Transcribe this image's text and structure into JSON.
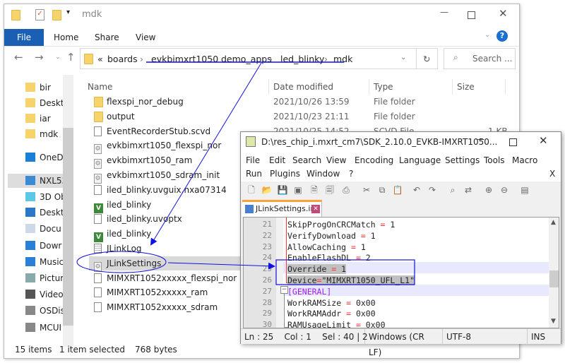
{
  "explorer": {
    "title": "mdk",
    "ribbon_tabs": [
      "File",
      "Home",
      "Share",
      "View"
    ],
    "breadcrumb": [
      "boards",
      "evkbimxrt1050",
      "demo_apps",
      "led_blinky",
      "mdk"
    ],
    "breadcrumb_overflow": "«",
    "search_placeholder": "Search ...",
    "columns": [
      "Name",
      "Date modified",
      "Type",
      "Size"
    ],
    "nav": [
      {
        "label": "bir",
        "icon": "folder-synced-icon"
      },
      {
        "label": "Deskt",
        "icon": "folder-icon"
      },
      {
        "label": "iar",
        "icon": "folder-icon"
      },
      {
        "label": "mdk",
        "icon": "folder-icon"
      },
      {
        "label": "OneDri",
        "icon": "onedrive-icon"
      },
      {
        "label": "NXL535",
        "icon": "computer-icon"
      },
      {
        "label": "3D Ob",
        "icon": "3d-objects-icon"
      },
      {
        "label": "Deskt",
        "icon": "desktop-icon"
      },
      {
        "label": "Docu",
        "icon": "documents-icon"
      },
      {
        "label": "Dowr",
        "icon": "downloads-icon"
      },
      {
        "label": "Music",
        "icon": "music-icon"
      },
      {
        "label": "Pictur",
        "icon": "pictures-icon"
      },
      {
        "label": "Video",
        "icon": "videos-icon"
      },
      {
        "label": "OSDis",
        "icon": "drive-icon"
      },
      {
        "label": "MCUI",
        "icon": "drive-icon"
      }
    ],
    "files": [
      {
        "name": "flexspi_nor_debug",
        "date": "2021/10/26 13:59",
        "type": "File folder",
        "size": "",
        "icon": "folder"
      },
      {
        "name": "output",
        "date": "2021/10/23 21:11",
        "type": "File folder",
        "size": "",
        "icon": "folder"
      },
      {
        "name": "EventRecorderStub.scvd",
        "date": "2021/10/25 14:52",
        "type": "SCVD File",
        "size": "1 KB",
        "icon": "file"
      },
      {
        "name": "evkbimxrt1050_flexspi_nor",
        "icon": "gear"
      },
      {
        "name": "evkbimxrt1050_ram",
        "icon": "gear"
      },
      {
        "name": "evkbimxrt1050_sdram_init",
        "icon": "gear"
      },
      {
        "name": "iled_blinky.uvguix.nxa07314",
        "icon": "file"
      },
      {
        "name": "iled_blinky",
        "icon": "vs"
      },
      {
        "name": "iled_blinky.uvoptx",
        "icon": "file"
      },
      {
        "name": "iled_blinky",
        "icon": "vs"
      },
      {
        "name": "JLinkLog",
        "icon": "text"
      },
      {
        "name": "JLinkSettings",
        "icon": "gear",
        "selected": true
      },
      {
        "name": "MIMXRT1052xxxxx_flexspi_nor",
        "icon": "file"
      },
      {
        "name": "MIMXRT1052xxxxx_ram",
        "icon": "file"
      },
      {
        "name": "MIMXRT1052xxxxx_sdram",
        "icon": "file"
      }
    ],
    "status": {
      "items": "15 items",
      "selected": "1 item selected",
      "size": "768 bytes"
    }
  },
  "npp": {
    "title": "D:\\res_chip_i.mxrt_cm7\\SDK_2.10.0_EVKB-IMXRT1050...",
    "menu_row1": [
      "File",
      "Edit",
      "Search",
      "View",
      "Encoding",
      "Language",
      "Settings",
      "Tools",
      "Macro"
    ],
    "menu_row2": [
      "Run",
      "Plugins",
      "Window",
      "?"
    ],
    "close_doc": "X",
    "tab": "JLinkSettings.ini",
    "lines": [
      {
        "n": "21",
        "key": "SkipProgOnCRCMatch",
        "op": " = ",
        "val": "1"
      },
      {
        "n": "22",
        "key": "VerifyDownload",
        "op": " = ",
        "val": "1"
      },
      {
        "n": "23",
        "key": "AllowCaching",
        "op": " = ",
        "val": "1"
      },
      {
        "n": "24",
        "key": "EnableFlashDL",
        "op": " = ",
        "val": "2"
      },
      {
        "n": "25",
        "key": "Override",
        "op": " = ",
        "val": "1",
        "sel": true
      },
      {
        "n": "26",
        "key": "Device",
        "op": "=",
        "val": "\"MIMXRT1050_UFL_L1\"",
        "sel": true
      },
      {
        "n": "27",
        "section": "[GENERAL]"
      },
      {
        "n": "28",
        "key": "WorkRAMSize",
        "op": " = ",
        "val": "0x00"
      },
      {
        "n": "29",
        "key": "WorkRAMAddr",
        "op": " = ",
        "val": "0x00"
      },
      {
        "n": "30",
        "key": "RAMUsageLimit",
        "op": " = ",
        "val": "0x00"
      }
    ],
    "status": {
      "pos": "Ln : 25    Col : 1    Sel : 40 | 2",
      "eol": "Windows (CR LF)",
      "enc": "UTF-8",
      "mode": "INS"
    }
  },
  "colors": {
    "accent": "#1a5fb4",
    "annotation": "#1010e0",
    "section": "#a020f0",
    "operator": "#ff3030"
  }
}
